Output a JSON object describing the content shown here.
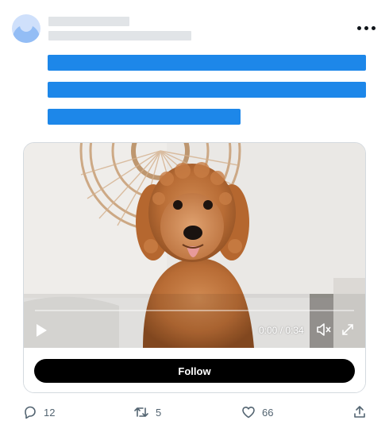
{
  "video": {
    "time_display": "0:00 / 0:34",
    "progress_fraction": 0.0
  },
  "follow_button": {
    "label": "Follow"
  },
  "actions": {
    "replies": "12",
    "retweets": "5",
    "likes": "66"
  },
  "colors": {
    "skeleton_gray": "#e1e4e7",
    "skeleton_blue": "#1d87e9",
    "avatar_light": "#cfe0fb",
    "avatar_dark": "#93bdf5",
    "button_black": "#000000",
    "icon_gray": "#536471"
  },
  "icons": [
    "more-icon",
    "play-icon",
    "mute-icon",
    "fullscreen-icon",
    "reply-icon",
    "retweet-icon",
    "like-icon",
    "share-icon"
  ]
}
